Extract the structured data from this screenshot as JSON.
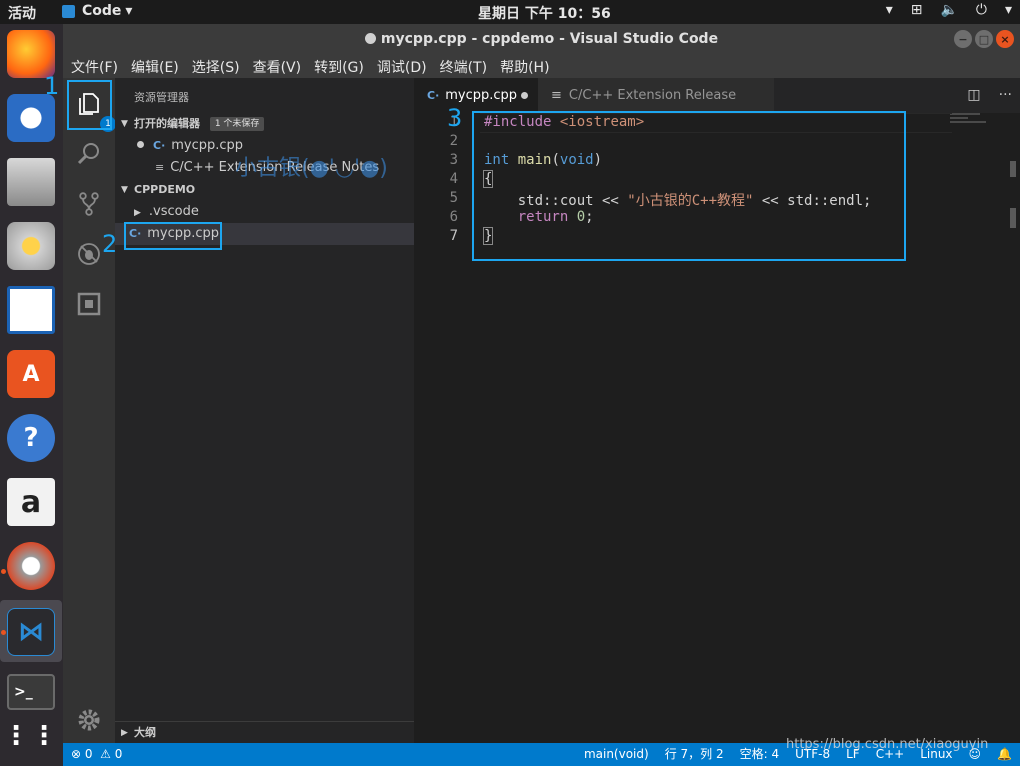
{
  "topbar": {
    "activities": "活动",
    "app_name": "Code",
    "clock": "星期日 下午 10：56"
  },
  "window": {
    "title": "mycpp.cpp - cppdemo - Visual Studio Code"
  },
  "menu": [
    "文件(F)",
    "编辑(E)",
    "选择(S)",
    "查看(V)",
    "转到(G)",
    "调试(D)",
    "终端(T)",
    "帮助(H)"
  ],
  "activity_bar": {
    "explorer_badge": "1"
  },
  "sidebar": {
    "header": "资源管理器",
    "open_editors": {
      "title": "打开的编辑器",
      "unsaved_badge": "1 个未保存",
      "items": [
        "mycpp.cpp",
        "C/C++ Extension Release Notes"
      ]
    },
    "folder": {
      "title": "CPPDEMO",
      "items": [
        ".vscode",
        "mycpp.cpp"
      ]
    },
    "outline": "大纲"
  },
  "tabs": [
    {
      "label": "mycpp.cpp",
      "dirty": true
    },
    {
      "label": "C/C++ Extension Release Notes",
      "dirty": false
    }
  ],
  "editor": {
    "line_numbers": [
      "1",
      "2",
      "3",
      "4",
      "5",
      "6",
      "7"
    ],
    "code": {
      "l1_directive": "#include",
      "l1_header": "<iostream>",
      "l3_type": "int",
      "l3_fn": "main",
      "l3_open": "(",
      "l3_void": "void",
      "l3_close": ")",
      "l4": "{",
      "l5_cout": "std::cout << ",
      "l5_str": "\"小古银的C++教程\"",
      "l5_endl": " << std::endl;",
      "l6_return": "return",
      "l6_num": "0",
      "l6_semi": ";",
      "l7": "}"
    }
  },
  "statusbar": {
    "errors": "⊗ 0",
    "warnings": "⚠ 0",
    "function": "main(void)",
    "position": "行 7，列 2",
    "indent": "空格: 4",
    "encoding": "UTF-8",
    "eol": "LF",
    "language": "C++",
    "platform": "Linux"
  },
  "annotations": {
    "n1": "1",
    "n2": "2",
    "n3": "3",
    "watermark": "小古银(●'◡'●)",
    "url": "https://blog.csdn.net/xiaoguyin"
  },
  "colors": {
    "accent": "#007acc",
    "annotation": "#1da6f0"
  }
}
